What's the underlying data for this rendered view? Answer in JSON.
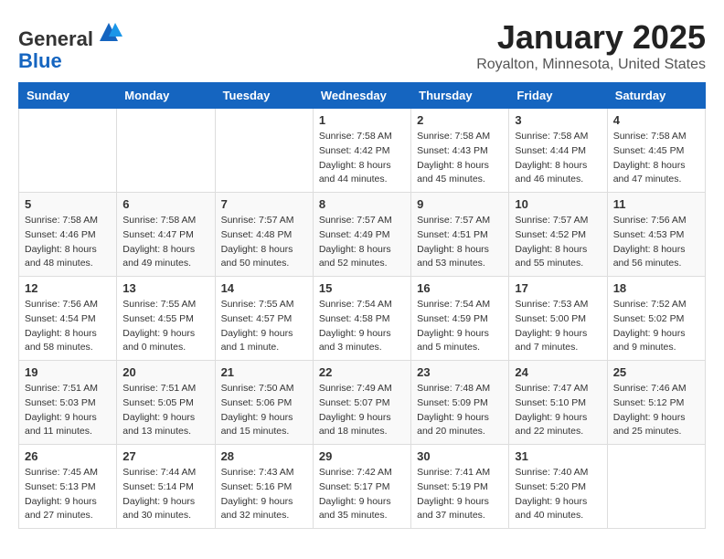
{
  "logo": {
    "general": "General",
    "blue": "Blue"
  },
  "header": {
    "month": "January 2025",
    "location": "Royalton, Minnesota, United States"
  },
  "weekdays": [
    "Sunday",
    "Monday",
    "Tuesday",
    "Wednesday",
    "Thursday",
    "Friday",
    "Saturday"
  ],
  "weeks": [
    [
      {
        "day": "",
        "info": ""
      },
      {
        "day": "",
        "info": ""
      },
      {
        "day": "",
        "info": ""
      },
      {
        "day": "1",
        "info": "Sunrise: 7:58 AM\nSunset: 4:42 PM\nDaylight: 8 hours\nand 44 minutes."
      },
      {
        "day": "2",
        "info": "Sunrise: 7:58 AM\nSunset: 4:43 PM\nDaylight: 8 hours\nand 45 minutes."
      },
      {
        "day": "3",
        "info": "Sunrise: 7:58 AM\nSunset: 4:44 PM\nDaylight: 8 hours\nand 46 minutes."
      },
      {
        "day": "4",
        "info": "Sunrise: 7:58 AM\nSunset: 4:45 PM\nDaylight: 8 hours\nand 47 minutes."
      }
    ],
    [
      {
        "day": "5",
        "info": "Sunrise: 7:58 AM\nSunset: 4:46 PM\nDaylight: 8 hours\nand 48 minutes."
      },
      {
        "day": "6",
        "info": "Sunrise: 7:58 AM\nSunset: 4:47 PM\nDaylight: 8 hours\nand 49 minutes."
      },
      {
        "day": "7",
        "info": "Sunrise: 7:57 AM\nSunset: 4:48 PM\nDaylight: 8 hours\nand 50 minutes."
      },
      {
        "day": "8",
        "info": "Sunrise: 7:57 AM\nSunset: 4:49 PM\nDaylight: 8 hours\nand 52 minutes."
      },
      {
        "day": "9",
        "info": "Sunrise: 7:57 AM\nSunset: 4:51 PM\nDaylight: 8 hours\nand 53 minutes."
      },
      {
        "day": "10",
        "info": "Sunrise: 7:57 AM\nSunset: 4:52 PM\nDaylight: 8 hours\nand 55 minutes."
      },
      {
        "day": "11",
        "info": "Sunrise: 7:56 AM\nSunset: 4:53 PM\nDaylight: 8 hours\nand 56 minutes."
      }
    ],
    [
      {
        "day": "12",
        "info": "Sunrise: 7:56 AM\nSunset: 4:54 PM\nDaylight: 8 hours\nand 58 minutes."
      },
      {
        "day": "13",
        "info": "Sunrise: 7:55 AM\nSunset: 4:55 PM\nDaylight: 9 hours\nand 0 minutes."
      },
      {
        "day": "14",
        "info": "Sunrise: 7:55 AM\nSunset: 4:57 PM\nDaylight: 9 hours\nand 1 minute."
      },
      {
        "day": "15",
        "info": "Sunrise: 7:54 AM\nSunset: 4:58 PM\nDaylight: 9 hours\nand 3 minutes."
      },
      {
        "day": "16",
        "info": "Sunrise: 7:54 AM\nSunset: 4:59 PM\nDaylight: 9 hours\nand 5 minutes."
      },
      {
        "day": "17",
        "info": "Sunrise: 7:53 AM\nSunset: 5:00 PM\nDaylight: 9 hours\nand 7 minutes."
      },
      {
        "day": "18",
        "info": "Sunrise: 7:52 AM\nSunset: 5:02 PM\nDaylight: 9 hours\nand 9 minutes."
      }
    ],
    [
      {
        "day": "19",
        "info": "Sunrise: 7:51 AM\nSunset: 5:03 PM\nDaylight: 9 hours\nand 11 minutes."
      },
      {
        "day": "20",
        "info": "Sunrise: 7:51 AM\nSunset: 5:05 PM\nDaylight: 9 hours\nand 13 minutes."
      },
      {
        "day": "21",
        "info": "Sunrise: 7:50 AM\nSunset: 5:06 PM\nDaylight: 9 hours\nand 15 minutes."
      },
      {
        "day": "22",
        "info": "Sunrise: 7:49 AM\nSunset: 5:07 PM\nDaylight: 9 hours\nand 18 minutes."
      },
      {
        "day": "23",
        "info": "Sunrise: 7:48 AM\nSunset: 5:09 PM\nDaylight: 9 hours\nand 20 minutes."
      },
      {
        "day": "24",
        "info": "Sunrise: 7:47 AM\nSunset: 5:10 PM\nDaylight: 9 hours\nand 22 minutes."
      },
      {
        "day": "25",
        "info": "Sunrise: 7:46 AM\nSunset: 5:12 PM\nDaylight: 9 hours\nand 25 minutes."
      }
    ],
    [
      {
        "day": "26",
        "info": "Sunrise: 7:45 AM\nSunset: 5:13 PM\nDaylight: 9 hours\nand 27 minutes."
      },
      {
        "day": "27",
        "info": "Sunrise: 7:44 AM\nSunset: 5:14 PM\nDaylight: 9 hours\nand 30 minutes."
      },
      {
        "day": "28",
        "info": "Sunrise: 7:43 AM\nSunset: 5:16 PM\nDaylight: 9 hours\nand 32 minutes."
      },
      {
        "day": "29",
        "info": "Sunrise: 7:42 AM\nSunset: 5:17 PM\nDaylight: 9 hours\nand 35 minutes."
      },
      {
        "day": "30",
        "info": "Sunrise: 7:41 AM\nSunset: 5:19 PM\nDaylight: 9 hours\nand 37 minutes."
      },
      {
        "day": "31",
        "info": "Sunrise: 7:40 AM\nSunset: 5:20 PM\nDaylight: 9 hours\nand 40 minutes."
      },
      {
        "day": "",
        "info": ""
      }
    ]
  ]
}
